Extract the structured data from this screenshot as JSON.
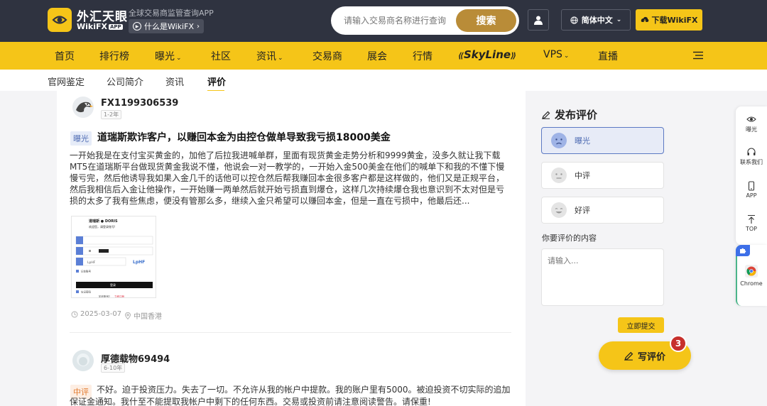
{
  "header": {
    "logo_cn": "外汇天眼",
    "logo_en": "WikiFX",
    "logo_app": "APP",
    "tagline": "全球交易商监管查询APP",
    "what_is": "什么是WikiFX",
    "search_placeholder": "请输入交易商名称进行查询",
    "search_button": "搜索",
    "language": "简体中文",
    "download": "下载WikiFX"
  },
  "nav": {
    "items": [
      "首页",
      "排行榜",
      "曝光",
      "社区",
      "资讯",
      "交易商",
      "展会",
      "行情",
      "SkyLine",
      "VPS",
      "直播"
    ]
  },
  "subtabs": [
    "官网鉴定",
    "公司简介",
    "资讯",
    "评价"
  ],
  "review1": {
    "username": "FX1199306539",
    "badge": "1-2年",
    "tag": "曝光",
    "title": "道瑞斯欺诈客户，以赚回本金为由控仓做单导致我亏损18000美金",
    "body": "一开始我是在支付宝买黄金的，加他了后拉我进喊单群，里面有现货黄金走势分析和9999黄金，没多久就让我下载MT5在道瑞斯平台做现货黄金我说不懂，他说会一对一教学的，一开始入金500美金在他们的喊单下和我的不懂下慢慢亏完，然后他诱导我如果入金几千的话他可以控仓然后帮我赚回本金很多客户都是这样做的，他们又是正规平台，然后我相信后入金让他操作，一开始赚一两单然后就开始亏损直到爆仓，这样几次持续爆仓我也意识到不太对但是亏损的太多了我有些焦虑，便没有管那么多，继续入金只希望可以赚回本金，但是一直在亏损中，他最后还...",
    "date": "2025-03-07",
    "location": "中国香港",
    "image": {
      "brand": "道瑞斯 ● DORIS",
      "welcome": "欢迎您，请登录账号!",
      "captcha": "LpHF",
      "remember": "记住账号",
      "login": "登录",
      "forgot": "忘记密码",
      "no_account": "如无账号?",
      "register": "立即注册"
    }
  },
  "review2": {
    "username": "厚德载物69494",
    "badge": "6-10年",
    "tag": "中评",
    "body": "不好。迫于投资压力。失去了一切。不允许从我的帐户中提款。我的账户里有5000。被迫投资不切实际的追加保证金通知。我什至不能提取我帐户中剩下的任何东西。交易或投资前请注意阅读警告。请保重!"
  },
  "panel": {
    "title": "发布评价",
    "options": [
      "曝光",
      "中评",
      "好评"
    ],
    "content_label": "你要评价的内容",
    "placeholder": "请输入...",
    "submit": "立即提交"
  },
  "write_review": {
    "label": "写评价",
    "badge": "3"
  },
  "float_bar": {
    "items": [
      "曝光",
      "联系我们",
      "APP",
      "TOP"
    ],
    "chrome": "Chrome"
  },
  "colors": {
    "header_bg": "#2f3340",
    "accent_yellow": "#f5c518",
    "search_gold": "#b98c38",
    "exposure_blue": "#4e6bb3",
    "neutral_orange": "#e27a2d",
    "badge_red": "#c7302c"
  }
}
